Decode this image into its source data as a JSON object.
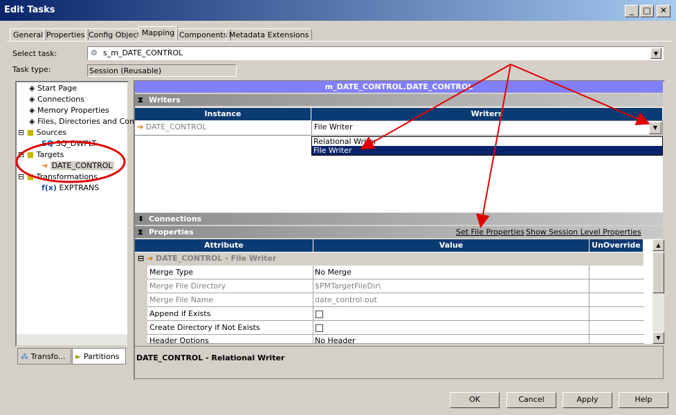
{
  "window": {
    "title": "Edit Tasks"
  },
  "tabs": [
    "General",
    "Properties",
    "Config Object",
    "Mapping",
    "Components",
    "Metadata Extensions"
  ],
  "active_tab": "Mapping",
  "select_task": {
    "label": "Select task:",
    "value": "s_m_DATE_CONTROL"
  },
  "task_type": {
    "label": "Task type:",
    "value": "Session (Reusable)"
  },
  "tree": {
    "items": [
      "Start Page",
      "Connections",
      "Memory Properties",
      "Files, Directories and Commands",
      "Sources",
      "SQ_DWPLT",
      "Targets",
      "DATE_CONTROL",
      "Transformations",
      "EXPTRANS"
    ],
    "bottom_tabs": [
      "Transfo...",
      "Partitions"
    ]
  },
  "mapping": {
    "header": "m_DATE_CONTROL.DATE_CONTROL",
    "writers_section": "Writers",
    "columns": [
      "Instance",
      "Writers"
    ],
    "row": {
      "instance": "DATE_CONTROL",
      "writer": "File Writer"
    },
    "dropdown_options": [
      "Relational Writer",
      "File Writer"
    ],
    "selected_option": "File Writer",
    "connections_section": "Connections",
    "properties_section": "Properties",
    "set_file_properties": "Set File Properties",
    "show_session_props": "Show Session Level Properties",
    "prop_columns": [
      "Attribute",
      "Value",
      "UnOverride"
    ],
    "group": "DATE_CONTROL - File Writer",
    "rows": [
      {
        "attr": "Merge Type",
        "value": "No Merge",
        "disabled": false
      },
      {
        "attr": "Merge File Directory",
        "value": "$PMTargetFileDir\\",
        "disabled": true
      },
      {
        "attr": "Merge File Name",
        "value": "date_control.out",
        "disabled": true
      },
      {
        "attr": "Append if Exists",
        "value": "",
        "checkbox": true
      },
      {
        "attr": "Create Directory if Not Exists",
        "value": "",
        "checkbox": true
      },
      {
        "attr": "Header Options",
        "value": "No Header"
      }
    ],
    "status": "DATE_CONTROL - Relational Writer"
  },
  "buttons": {
    "ok": "OK",
    "cancel": "Cancel",
    "apply": "Apply",
    "help": "Help"
  },
  "annotation_color": "#e00000"
}
